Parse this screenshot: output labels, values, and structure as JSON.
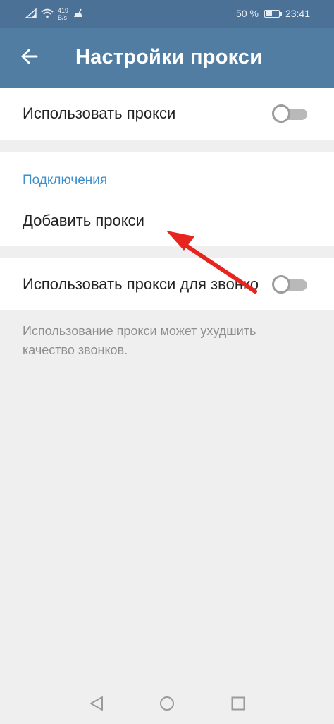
{
  "status_bar": {
    "net_speed_value": "419",
    "net_speed_unit": "B/s",
    "battery": "50 %",
    "battery_level": 0.5,
    "time": "23:41"
  },
  "app_bar": {
    "title": "Настройки прокси",
    "back_icon": "arrow-left-icon"
  },
  "settings": {
    "use_proxy_label": "Использовать прокси",
    "use_proxy_enabled": false,
    "connections_header": "Подключения",
    "add_proxy_label": "Добавить прокси",
    "use_proxy_calls_label": "Использовать прокси для звонков",
    "use_proxy_calls_enabled": false,
    "calls_hint": "Использование прокси может ухудшить качество звонков."
  },
  "colors": {
    "status_bar": "#4b7196",
    "app_bar": "#517da2",
    "accent": "#3d8fce",
    "annotation_arrow": "#e8241f"
  },
  "nav_bar": {
    "back": "triangle-back-icon",
    "home": "circle-home-icon",
    "recents": "square-recents-icon"
  }
}
